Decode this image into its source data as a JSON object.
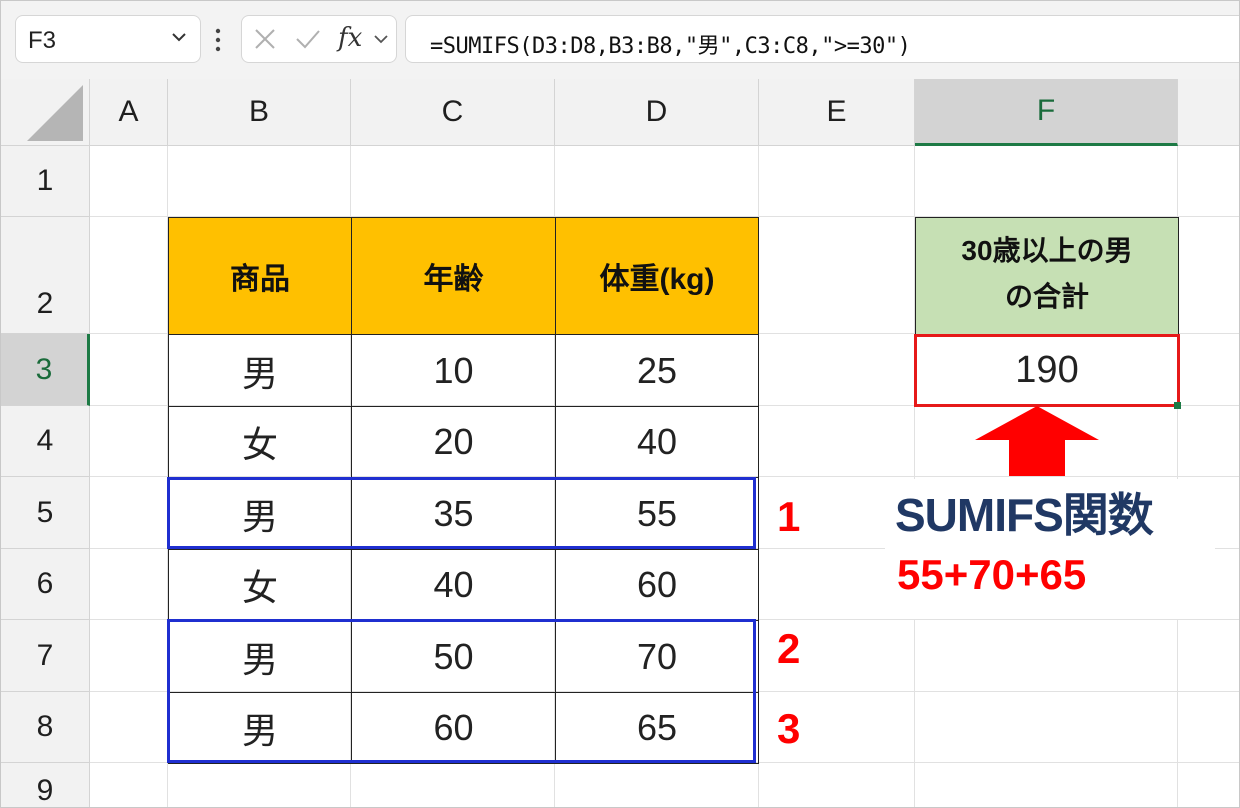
{
  "formula_bar": {
    "name_box": "F3",
    "fx_label": "fx",
    "formula": "=SUMIFS(D3:D8,B3:B8,\"男\",C3:C8,\">=30\")"
  },
  "columns": [
    "A",
    "B",
    "C",
    "D",
    "E",
    "F"
  ],
  "rows": [
    "1",
    "2",
    "3",
    "4",
    "5",
    "6",
    "7",
    "8",
    "9"
  ],
  "selected_cell": "F3",
  "table": {
    "headers": [
      "商品",
      "年齢",
      "体重(kg)"
    ],
    "rows": [
      [
        "男",
        "10",
        "25"
      ],
      [
        "女",
        "20",
        "40"
      ],
      [
        "男",
        "35",
        "55"
      ],
      [
        "女",
        "40",
        "60"
      ],
      [
        "男",
        "50",
        "70"
      ],
      [
        "男",
        "60",
        "65"
      ]
    ]
  },
  "result": {
    "header_line1": "30歳以上の男",
    "header_line2": "の合計",
    "value": "190"
  },
  "markers": [
    "1",
    "2",
    "3"
  ],
  "annotation": {
    "title": "SUMIFS関数",
    "expression": "55+70+65"
  },
  "colors": {
    "header_fill": "#ffc000",
    "result_header_fill": "#c6e0b4",
    "highlight_border": "#1f2fd0",
    "result_border": "#e61919",
    "arrow": "#ff0000",
    "title_text": "#203864"
  }
}
